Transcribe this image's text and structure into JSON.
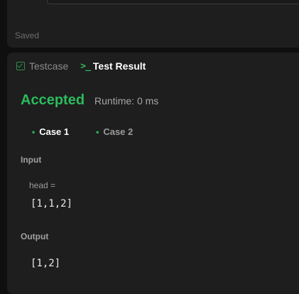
{
  "editor": {
    "saved_status": "Saved"
  },
  "tabs": [
    {
      "label": "Testcase",
      "icon": "checkbox-icon"
    },
    {
      "label": "Test Result",
      "icon": "terminal-icon"
    }
  ],
  "result": {
    "status": "Accepted",
    "runtime": "Runtime: 0 ms",
    "status_color": "#2cbb5d"
  },
  "cases": [
    {
      "label": "Case 1",
      "active": true
    },
    {
      "label": "Case 2",
      "active": false
    }
  ],
  "input": {
    "label": "Input",
    "variable": "head =",
    "value": "[1,1,2]"
  },
  "output": {
    "label": "Output",
    "value": "[1,2]"
  }
}
